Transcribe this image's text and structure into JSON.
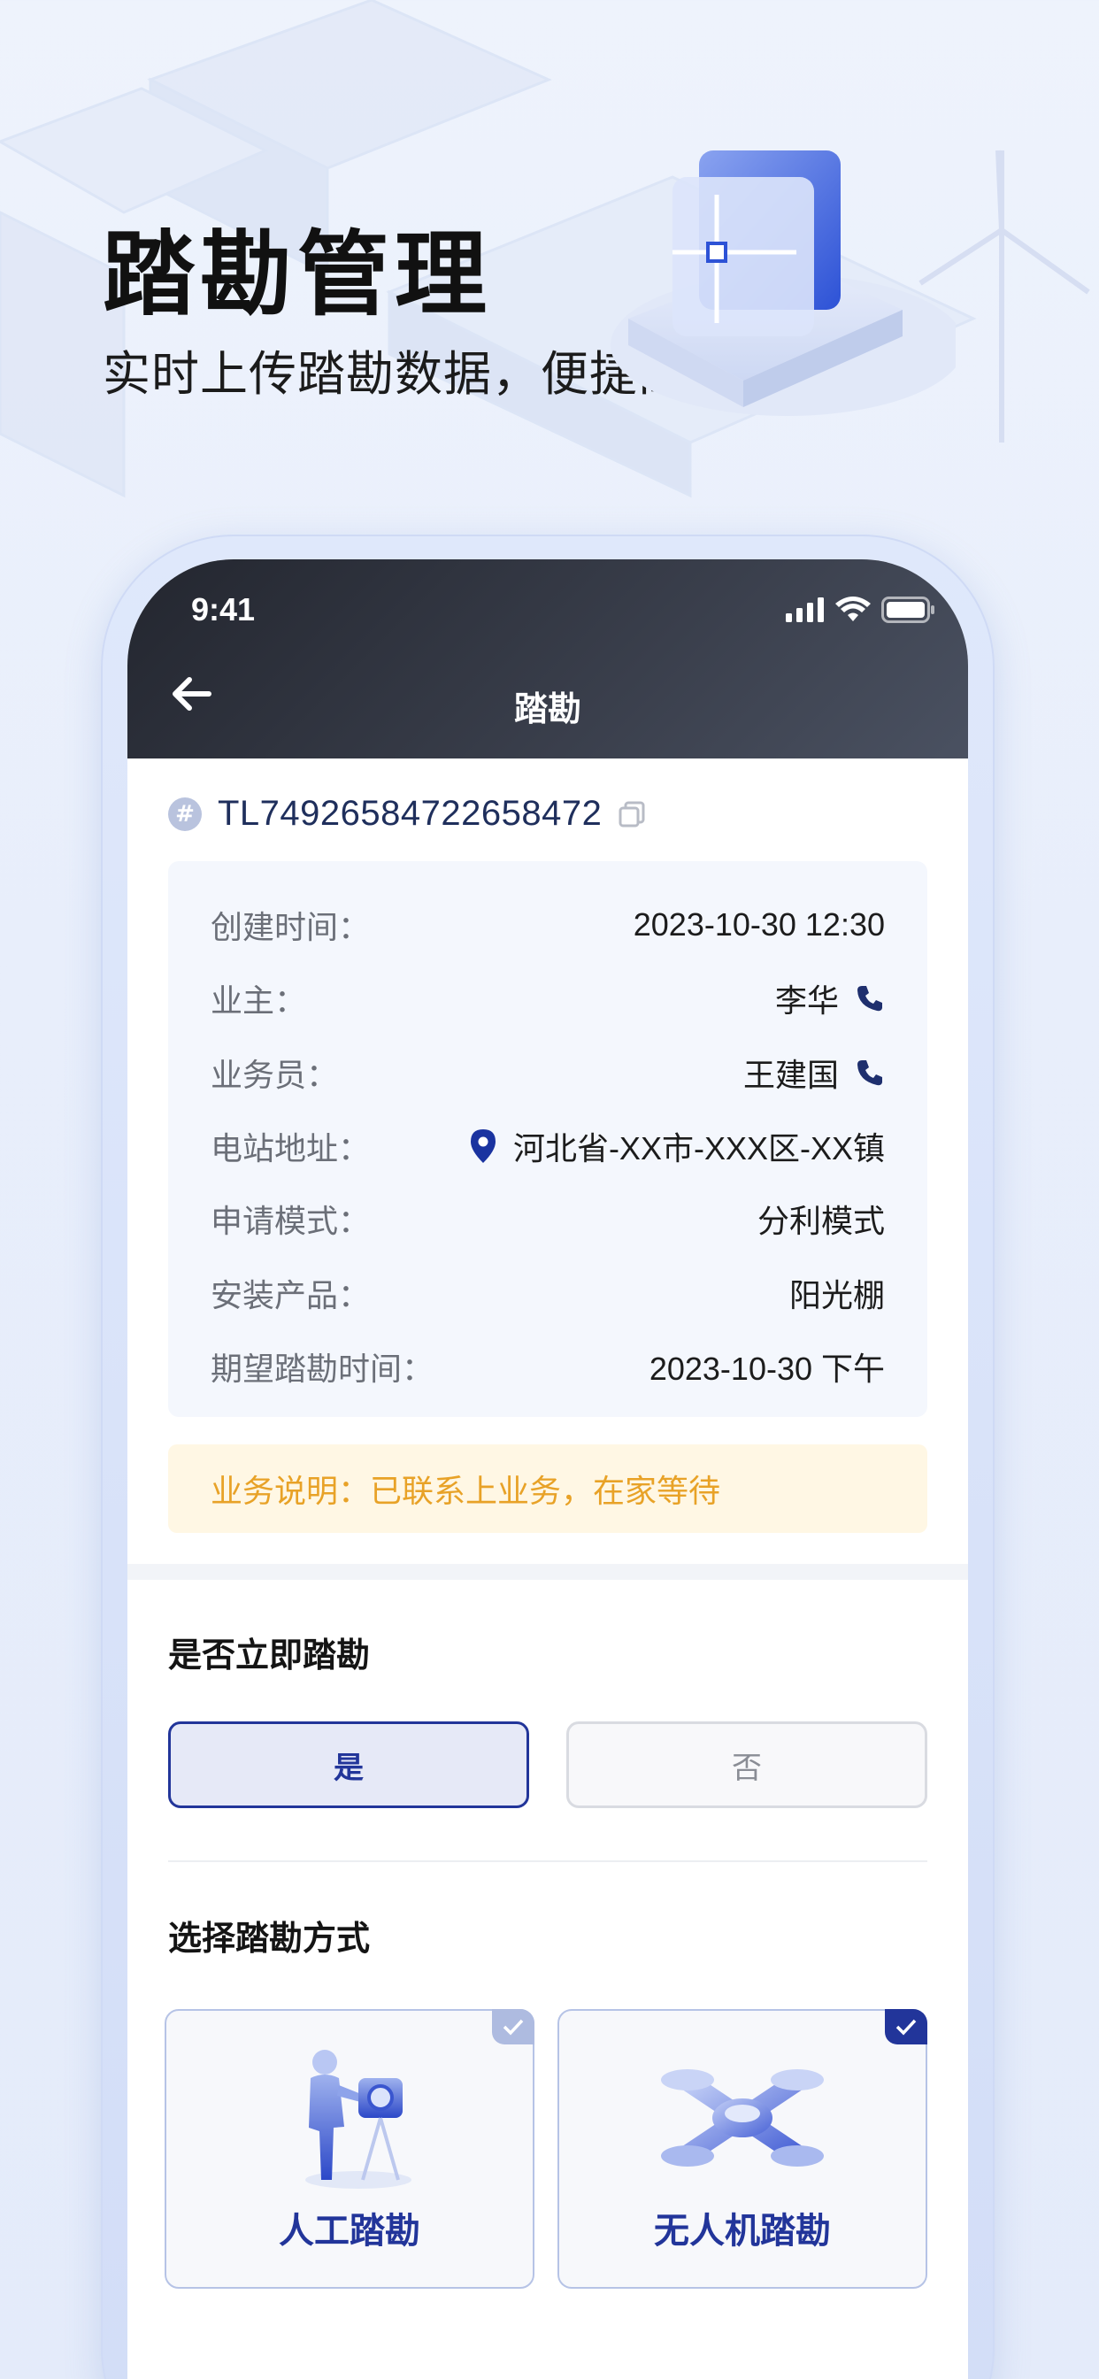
{
  "hero": {
    "title": "踏勘管理",
    "subtitle": "实时上传踏勘数据，便捷高效"
  },
  "status_bar": {
    "time": "9:41",
    "icons": [
      "signal-icon",
      "wifi-icon",
      "battery-icon"
    ]
  },
  "nav": {
    "back_icon": "arrow-left-icon",
    "title": "踏勘"
  },
  "order": {
    "icon": "hash-icon",
    "icon_glyph": "#",
    "number": "TL74926584722658472",
    "copy_icon": "copy-icon"
  },
  "details": [
    {
      "label": "创建时间：",
      "value": "2023-10-30 12:30"
    },
    {
      "label": "业主：",
      "value": "李华",
      "icon": "phone-icon"
    },
    {
      "label": "业务员：",
      "value": "王建国",
      "icon": "phone-icon"
    },
    {
      "label": "电站地址：",
      "value": "河北省-XX市-XXX区-XX镇",
      "icon": "location-pin-icon"
    },
    {
      "label": "申请模式：",
      "value": "分利模式"
    },
    {
      "label": "安装产品：",
      "value": "阳光棚"
    },
    {
      "label": "期望踏勘时间：",
      "value": "2023-10-30 下午"
    }
  ],
  "note": "业务说明：已联系上业务，在家等待",
  "immediate": {
    "title": "是否立即踏勘",
    "yes_label": "是",
    "no_label": "否",
    "selected": "是"
  },
  "method": {
    "title": "选择踏勘方式",
    "options": [
      {
        "label": "人工踏勘",
        "icon": "surveyor-icon",
        "checked_style": "light"
      },
      {
        "label": "无人机踏勘",
        "icon": "drone-icon",
        "checked_style": "dark"
      }
    ]
  },
  "colors": {
    "accent": "#22359a",
    "header_dark": "#2b2f3a",
    "note_text": "#e8a227",
    "note_bg": "#fff7e4",
    "info_bg": "#f4f7fd"
  }
}
